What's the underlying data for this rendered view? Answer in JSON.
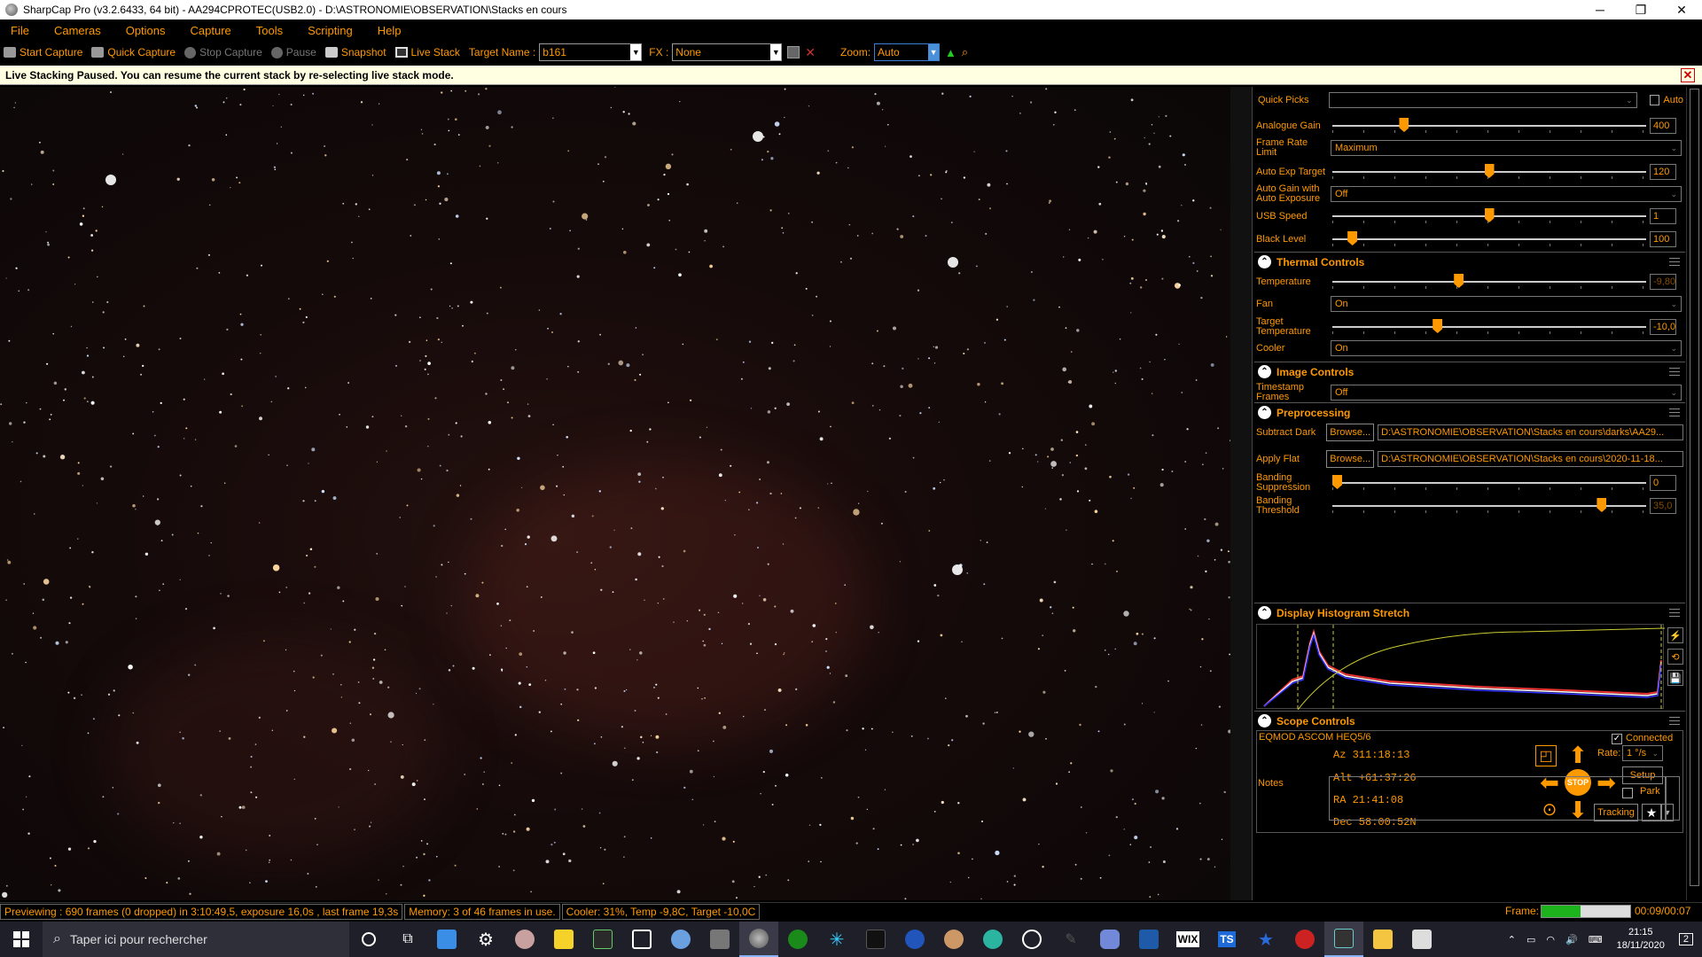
{
  "window": {
    "title": "SharpCap Pro (v3.2.6433, 64 bit) - AA294CPROTEC(USB2.0) - D:\\ASTRONOMIE\\OBSERVATION\\Stacks en cours",
    "minimize": "─",
    "restore": "❐",
    "close": "✕"
  },
  "menu": [
    "File",
    "Cameras",
    "Options",
    "Capture",
    "Tools",
    "Scripting",
    "Help"
  ],
  "toolbar": {
    "start_capture": "Start Capture",
    "quick_capture": "Quick Capture",
    "stop_capture": "Stop Capture",
    "pause": "Pause",
    "snapshot": "Snapshot",
    "live_stack": "Live Stack",
    "target_name_label": "Target Name :",
    "target_name_value": "b161",
    "fx_label": "FX :",
    "fx_value": "None",
    "zoom_label": "Zoom:",
    "zoom_value": "Auto"
  },
  "notification": {
    "text": "Live Stacking Paused. You can resume the current stack by re-selecting live stack mode.",
    "close": "✕"
  },
  "camera_controls": {
    "quick_picks_label": "Quick Picks",
    "quick_picks_value": "",
    "auto_label": "Auto",
    "analogue_gain": {
      "label": "Analogue Gain",
      "value": "400",
      "position": 0.22
    },
    "frame_rate_limit": {
      "label": "Frame Rate Limit",
      "value": "Maximum"
    },
    "auto_exp_target": {
      "label": "Auto Exp Target",
      "value": "120",
      "position": 0.5
    },
    "auto_gain_with_auto_exposure": {
      "label": "Auto Gain with Auto Exposure",
      "value": "Off"
    },
    "usb_speed": {
      "label": "USB Speed",
      "value": "1",
      "position": 0.5
    },
    "black_level": {
      "label": "Black Level",
      "value": "100",
      "position": 0.05
    }
  },
  "thermal": {
    "title": "Thermal Controls",
    "temperature": {
      "label": "Temperature",
      "value": "-9,80",
      "position": 0.4
    },
    "fan": {
      "label": "Fan",
      "value": "On"
    },
    "target_temperature": {
      "label": "Target Temperature",
      "value": "-10,0",
      "position": 0.33
    },
    "cooler": {
      "label": "Cooler",
      "value": "On"
    }
  },
  "image_controls": {
    "title": "Image Controls",
    "timestamp_frames": {
      "label": "Timestamp Frames",
      "value": "Off"
    }
  },
  "preprocessing": {
    "title": "Preprocessing",
    "subtract_dark": {
      "label": "Subtract Dark",
      "browse": "Browse...",
      "path": "D:\\ASTRONOMIE\\OBSERVATION\\Stacks en cours\\darks\\AA29..."
    },
    "apply_flat": {
      "label": "Apply Flat",
      "browse": "Browse...",
      "path": "D:\\ASTRONOMIE\\OBSERVATION\\Stacks en cours\\2020-11-18..."
    },
    "banding_suppression": {
      "label": "Banding Suppression",
      "value": "0",
      "position": 0.0
    },
    "banding_threshold": {
      "label": "Banding Threshold",
      "value": "35,0",
      "position": 0.87
    }
  },
  "histogram": {
    "title": "Display Histogram Stretch",
    "buttons": [
      "⚡",
      "⟲",
      "💾"
    ]
  },
  "scope": {
    "title": "Scope Controls",
    "mount": "EQMOD ASCOM HEQ5/6",
    "connected_label": "Connected",
    "connected": true,
    "az": "Az   311:18:13",
    "alt": "Alt  +61:37:26",
    "ra": "RA   21:41:08",
    "dec": "Dec  58:00:52N",
    "rate_label": "Rate:",
    "rate_value": "1 °/s",
    "setup": "Setup",
    "park": "Park",
    "stop": "STOP",
    "tracking": "Tracking"
  },
  "notes": {
    "label": "Notes",
    "value": ""
  },
  "status": {
    "previewing": "Previewing : 690 frames (0 dropped) in 3:10:49,5, exposure 16,0s , last frame 19,3s",
    "memory": "Memory: 3 of 46 frames in use.",
    "cooler": "Cooler: 31%, Temp -9,8C, Target -10,0C",
    "frame_label": "Frame:",
    "frame_progress": 0.44,
    "frame_time": "00:09/00:07"
  },
  "taskbar": {
    "search_placeholder": "Taper ici pour rechercher",
    "time": "21:15",
    "date": "18/11/2020",
    "notification_count": "2"
  },
  "colors": {
    "accent": "#ff9900",
    "background": "#000000",
    "notification_bg": "#ffffe1",
    "histogram_yellow": "#cccc33"
  }
}
